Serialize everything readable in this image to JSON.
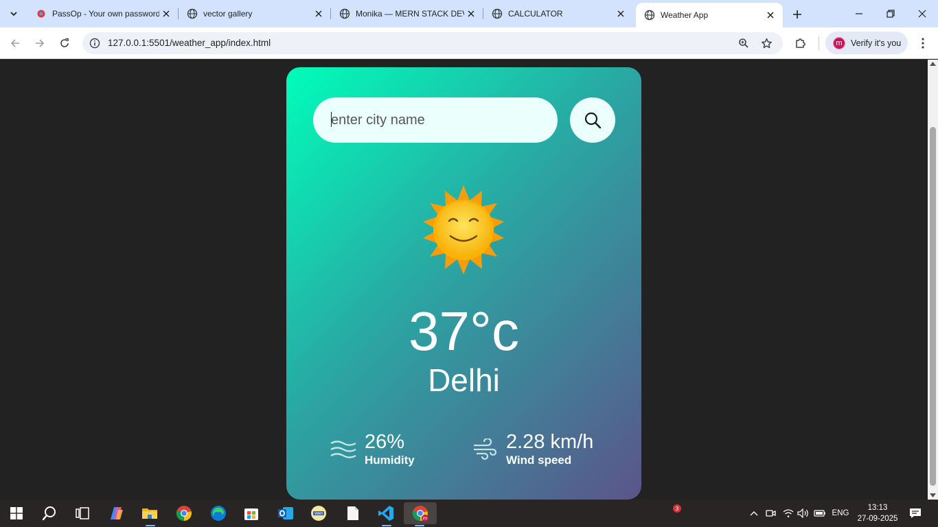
{
  "browser": {
    "tabs": [
      {
        "title": "PassOp - Your own password manager",
        "favicon": "passop-icon",
        "active": false
      },
      {
        "title": "vector gallery",
        "favicon": "globe-icon",
        "active": false
      },
      {
        "title": "Monika — MERN STACK DEVELOPER",
        "favicon": "globe-icon",
        "active": false
      },
      {
        "title": "CALCULATOR",
        "favicon": "globe-icon",
        "active": false
      },
      {
        "title": "Weather App",
        "favicon": "globe-icon",
        "active": true
      }
    ],
    "url": "127.0.0.1:5501/weather_app/index.html",
    "profile": {
      "initial": "m",
      "label": "Verify it's you"
    }
  },
  "weather": {
    "search": {
      "placeholder": "enter city name",
      "value": ""
    },
    "condition_icon": "sun-icon",
    "temperature": "37°c",
    "city": "Delhi",
    "humidity": {
      "value": "26%",
      "label": "Humidity",
      "icon": "humidity-icon"
    },
    "wind": {
      "value": "2.28 km/h",
      "label": "Wind speed",
      "icon": "wind-icon"
    }
  },
  "taskbar": {
    "apps": [
      "windows-start-icon",
      "search-icon",
      "task-view-icon",
      "copilot-icon",
      "file-explorer-icon",
      "chrome-icon",
      "edge-icon",
      "store-icon",
      "outlook-icon",
      "wah-app-icon",
      "notepad-icon",
      "vscode-icon",
      "chrome-profile-icon"
    ],
    "notification_badge": "3",
    "language": "ENG",
    "time": "13:13",
    "date": "27-09-2025"
  },
  "colors": {
    "card_gradient_start": "#00feba",
    "card_gradient_end": "#5b548a",
    "page_background": "#222222"
  }
}
